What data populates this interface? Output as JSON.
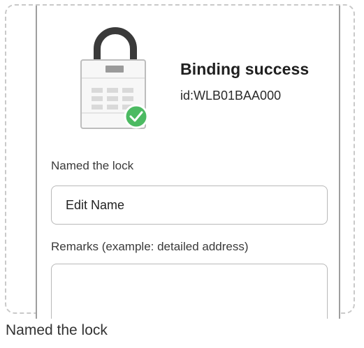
{
  "binding": {
    "title": "Binding success",
    "id": "id:WLB01BAA000"
  },
  "form": {
    "name_label": "Named the lock",
    "name_placeholder": "Edit Name",
    "remarks_label": "Remarks (example: detailed address)",
    "remarks_value": ""
  },
  "caption": "Named the lock",
  "icons": {
    "lock": "padlock-icon",
    "check": "check-badge-icon"
  },
  "colors": {
    "success_green": "#4cba62",
    "lock_shackle": "#3a3a3a",
    "lock_body": "#f7f7f7"
  }
}
